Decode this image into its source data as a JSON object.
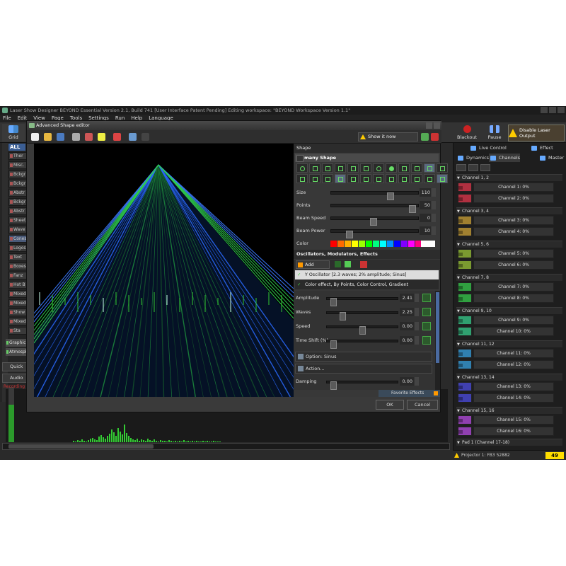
{
  "window": {
    "title": "Laser Show Designer BEYOND Essential    Version 2.1, Build 741    [User Interface Patent Pending]    Editing workspace: \"BEYOND Workspace Version 1.1\""
  },
  "menu": [
    "File",
    "Edit",
    "View",
    "Page",
    "Tools",
    "Settings",
    "Run",
    "Help",
    "Language"
  ],
  "toolbar": {
    "grid_label": "Grid",
    "blackout_label": "Blackout",
    "pause_label": "Pause",
    "disable_label": "Disable Laser Output"
  },
  "left_panel": {
    "all_label": "ALL",
    "categories": [
      "Ther",
      "Misc.",
      "Bckgr",
      "Bckgr",
      "Abstr",
      "Bckgr",
      "Abstr",
      "Sheet",
      "Wave",
      "Cones",
      "Logos",
      "Text",
      "Boxes",
      "Fanz",
      "Hot B",
      "Mixed",
      "Mixed",
      "Show",
      "Mixed",
      "Sta"
    ],
    "groups": [
      "Graphic",
      "Atmosph"
    ],
    "quick_label": "Quick",
    "audio_label": "Audio",
    "recording_label": "Recording"
  },
  "audio_level": 0.68,
  "visualizer_bars": [
    2,
    1,
    3,
    2,
    4,
    2,
    1,
    3,
    5,
    6,
    4,
    3,
    8,
    10,
    7,
    5,
    9,
    12,
    18,
    14,
    9,
    20,
    15,
    11,
    25,
    13,
    9,
    6,
    4,
    3,
    5,
    2,
    4,
    3,
    2,
    5,
    3,
    2,
    4,
    2,
    1,
    3,
    2,
    2,
    1,
    3,
    2,
    1,
    2,
    1,
    2,
    1,
    3,
    1,
    2,
    1,
    2,
    1,
    2,
    1,
    1,
    2,
    1,
    2,
    1,
    1,
    2,
    1,
    1,
    1
  ],
  "right_panel": {
    "live_control": "Live Control",
    "effect": "Effect",
    "dynamics": "Dynamics",
    "channels": "Channels",
    "master": "Master",
    "groups": [
      {
        "label": "Channel 1, 2",
        "color": "#b03040",
        "channels": [
          "Channel 1: 0%",
          "Channel 2: 0%"
        ]
      },
      {
        "label": "Channel 3, 4",
        "color": "#a08030",
        "channels": [
          "Channel 3: 0%",
          "Channel 4: 0%"
        ]
      },
      {
        "label": "Channel 5, 6",
        "color": "#7a9a30",
        "channels": [
          "Channel 5: 0%",
          "Channel 6: 0%"
        ]
      },
      {
        "label": "Channel 7, 8",
        "color": "#30a040",
        "channels": [
          "Channel 7: 0%",
          "Channel 8: 0%"
        ]
      },
      {
        "label": "Channel 9, 10",
        "color": "#30a070",
        "channels": [
          "Channel 9: 0%",
          "Channel 10: 0%"
        ]
      },
      {
        "label": "Channel 11, 12",
        "color": "#3080b0",
        "channels": [
          "Channel 11: 0%",
          "Channel 12: 0%"
        ]
      },
      {
        "label": "Channel 13, 14",
        "color": "#4040b0",
        "channels": [
          "Channel 13: 0%",
          "Channel 14: 0%"
        ]
      },
      {
        "label": "Channel 15, 16",
        "color": "#9040b0",
        "channels": [
          "Channel 15: 0%",
          "Channel 16: 0%"
        ]
      }
    ],
    "pad_label": "Pad 1 (Channel 17-18)"
  },
  "status": {
    "projector": "Projector 1: FB3 52882",
    "fps": "49 FPS"
  },
  "editor": {
    "title": "Advanced Shape editor",
    "show_it_now": "Show it now",
    "shape_header": "Shape",
    "shape_name": "many Shape",
    "params": [
      {
        "label": "Size",
        "value": "110",
        "pos": 0.69
      },
      {
        "label": "Points",
        "value": "50",
        "pos": 0.96
      },
      {
        "label": "Beam Speed",
        "value": "0",
        "pos": 0.48
      },
      {
        "label": "Beam Power",
        "value": "10",
        "pos": 0.18
      }
    ],
    "color_label": "Color",
    "palette": [
      "#ff0000",
      "#ff6a00",
      "#ffb000",
      "#ffff00",
      "#9aff00",
      "#00ff00",
      "#00ff80",
      "#00ffff",
      "#0090ff",
      "#0000ff",
      "#8000ff",
      "#ff00ff",
      "#ff0080"
    ],
    "osc_header": "Oscillators, Modulators, Effects",
    "add_label": "Add",
    "effects": [
      "Y Oscillator [2.3 waves; 2% amplitude; Sinus]",
      "Color effect, By Points, Color Control, Gradient"
    ],
    "osc_params": [
      {
        "label": "Amplitude",
        "value": "2.41",
        "pos": 0.05
      },
      {
        "label": "Waves",
        "value": "2.25",
        "pos": 0.2
      },
      {
        "label": "Speed",
        "value": "0.00",
        "pos": 0.5
      },
      {
        "label": "Time Shift (%)",
        "value": "0.00",
        "pos": 0.05
      }
    ],
    "option_label": "Option: Sinus",
    "action_label": "Action...",
    "damping": {
      "label": "Damping",
      "value": "0.00",
      "pos": 0.05
    },
    "favorite_label": "Favorite Effects",
    "ok_label": "OK",
    "cancel_label": "Cancel"
  }
}
